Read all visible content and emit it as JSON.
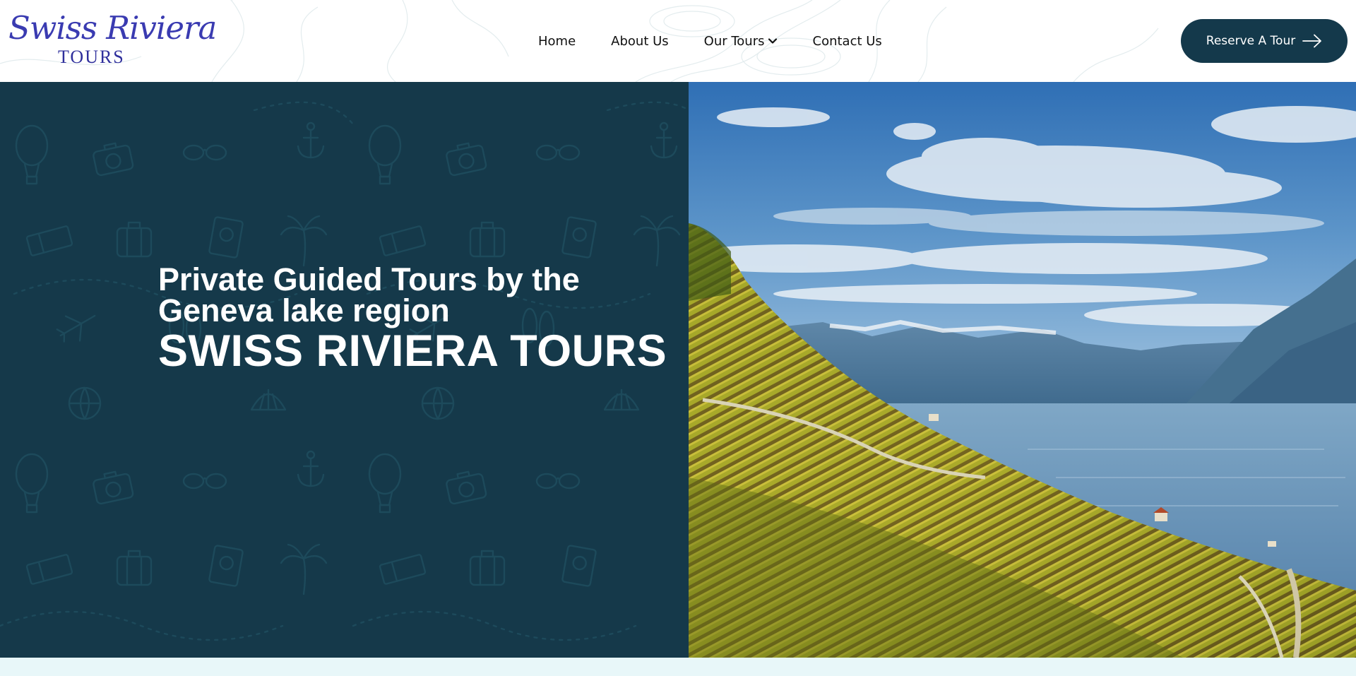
{
  "brand": {
    "logo_script": "Swiss Riviera",
    "logo_sub": "TOURS"
  },
  "nav": {
    "items": [
      "Home",
      "About Us",
      "Our Tours",
      "Contact Us"
    ]
  },
  "cta": {
    "label": "Reserve A Tour"
  },
  "hero": {
    "subtitle": "Private Guided Tours by the Geneva lake region",
    "title": "SWISS RIVIERA TOURS"
  },
  "icons": {
    "dropdown": "chevron-down-icon",
    "cta": "arrow-right-icon"
  },
  "colors": {
    "primary_dark": "#14394b",
    "logo_blue": "#3a3bb1",
    "page_bg": "#e9f6f8"
  }
}
